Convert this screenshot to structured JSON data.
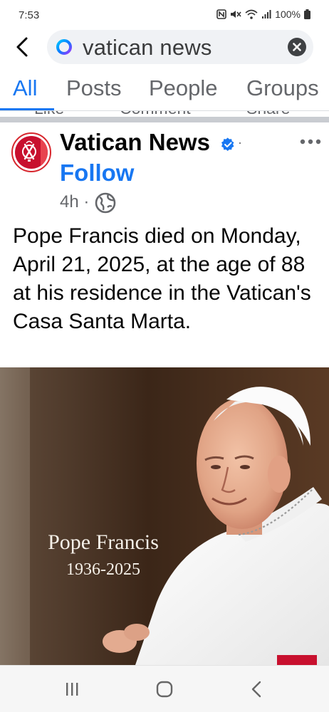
{
  "status_bar": {
    "time": "7:53",
    "battery": "100%"
  },
  "search": {
    "query": "vatican news"
  },
  "tabs": [
    {
      "label": "All",
      "active": true
    },
    {
      "label": "Posts",
      "active": false
    },
    {
      "label": "People",
      "active": false
    },
    {
      "label": "Groups",
      "active": false
    }
  ],
  "previous_post_actions": [
    "Like",
    "Comment",
    "Share"
  ],
  "post": {
    "page_name": "Vatican News",
    "dot": "·",
    "follow_label": "Follow",
    "timestamp": "4h ·",
    "text": "Pope Francis died on Monday, April 21, 2025, at the age of 88 at his residence in the Vatican's Casa Santa Marta.",
    "image": {
      "caption_title": "Pope Francis",
      "caption_years": "1936-2025"
    }
  },
  "colors": {
    "accent": "#1877f2",
    "brand_red": "#c8102e"
  },
  "icons": {
    "back": "back-arrow-icon",
    "search": "search-ring-icon",
    "clear": "clear-search-icon",
    "verified": "verified-badge-icon",
    "audience": "globe-icon",
    "more": "more-options-icon",
    "nav_recents": "recents-icon",
    "nav_home": "home-icon",
    "nav_back": "nav-back-icon"
  }
}
